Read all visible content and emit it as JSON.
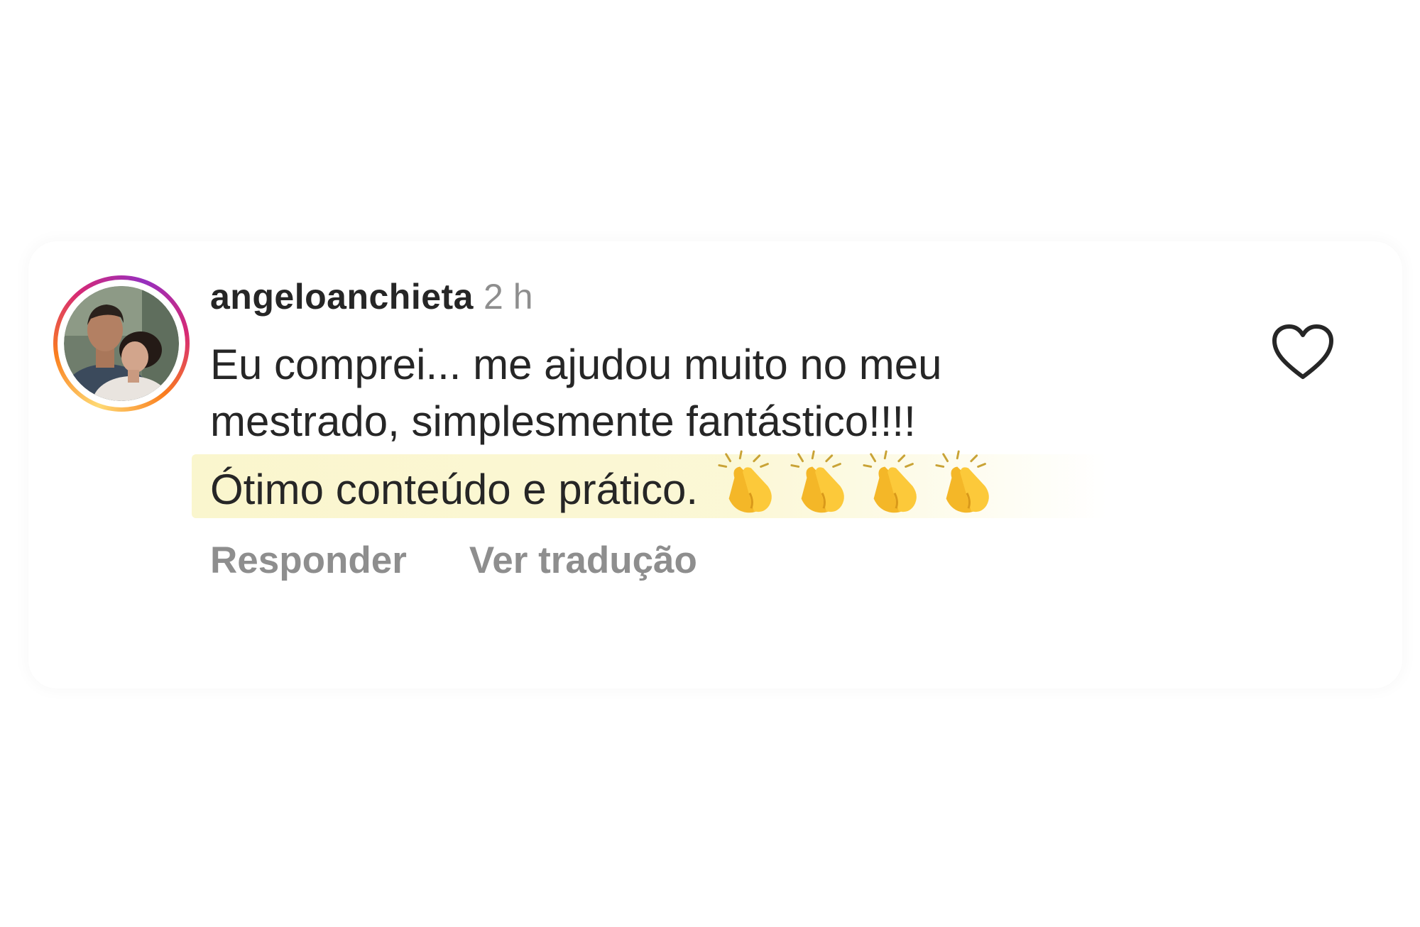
{
  "comment": {
    "username": "angeloanchieta",
    "timestamp": "2 h",
    "text_lines": [
      "Eu comprei... me ajudou muito no meu",
      "mestrado, simplesmente fantástico!!!!",
      "Ótimo conteúdo e prático."
    ],
    "emoji": [
      "clapping-hands",
      "clapping-hands",
      "clapping-hands",
      "clapping-hands"
    ],
    "actions": {
      "reply_label": "Responder",
      "translate_label": "Ver tradução"
    },
    "liked": false
  },
  "colors": {
    "text_primary": "#262626",
    "text_secondary": "#8e8e8e",
    "highlight": "#faf5c8",
    "avatar_ring": [
      "#feda75",
      "#fa7e1e",
      "#d62976",
      "#962fbf"
    ]
  }
}
